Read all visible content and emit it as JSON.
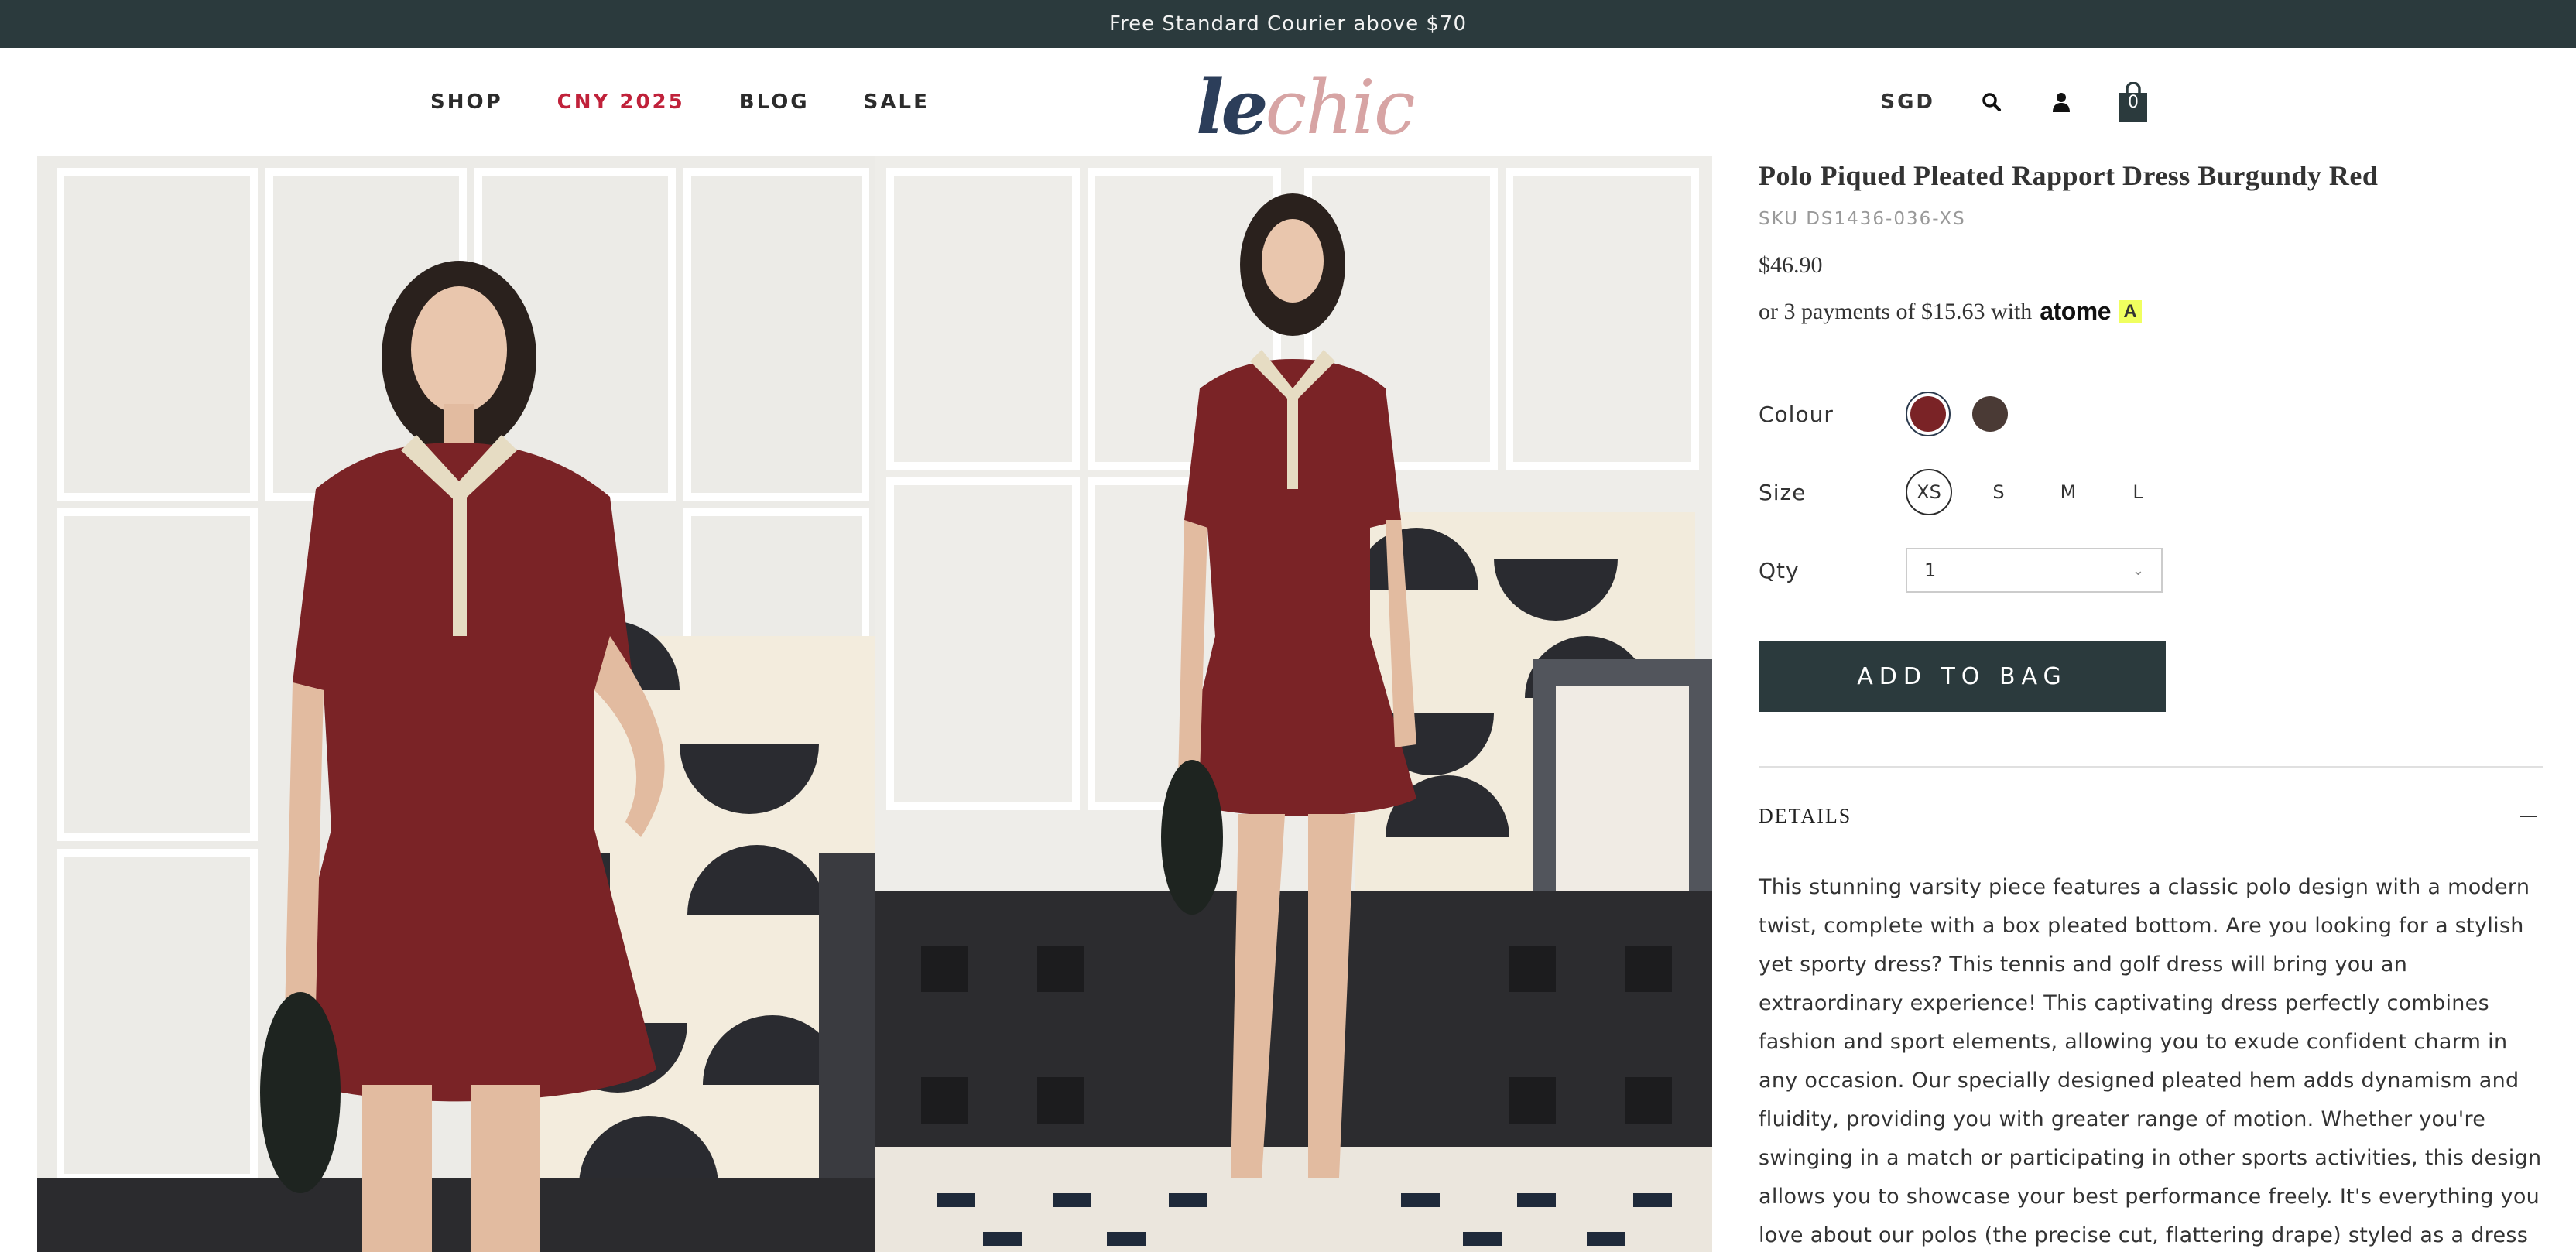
{
  "banner": {
    "text": "Free Standard Courier above $70"
  },
  "nav": {
    "shop": "SHOP",
    "cny": "CNY 2025",
    "blog": "BLOG",
    "sale": "SALE"
  },
  "logo": {
    "part1": "le",
    "part2": "chic"
  },
  "header": {
    "currency": "SGD",
    "bag_count": "0",
    "search_icon": "search-icon",
    "account_icon": "user-icon",
    "bag_icon": "shopping-bag-icon"
  },
  "product": {
    "title": "Polo Piqued Pleated Rapport Dress Burgundy Red",
    "sku": "SKU DS1436-036-XS",
    "price": "$46.90",
    "installment_text": "or 3 payments of $15.63 with",
    "installment_provider": "atome",
    "colour_label": "Colour",
    "colours": [
      "#7a2326",
      "#4a3a35"
    ],
    "size_label": "Size",
    "sizes": [
      "XS",
      "S",
      "M",
      "L"
    ],
    "selected_size": "XS",
    "qty_label": "Qty",
    "qty_value": "1",
    "add_to_bag": "ADD TO BAG",
    "details_heading": "DETAILS",
    "description": "This stunning varsity piece features a classic polo design with a modern twist, complete with a box pleated bottom. Are you looking for a stylish yet sporty dress? This tennis and golf dress will bring you an extraordinary experience! This captivating dress perfectly combines fashion and sport elements, allowing you to exude confident charm in any occasion. Our specially designed pleated hem adds dynamism and fluidity, providing you with greater range of motion. Whether you're swinging in a match or participating in other sports activities, this design allows you to showcase your best performance freely. It's everything you love about our polos (the precise cut, flattering drape) styled as a dress in comfortable, stretch cotton, and"
  },
  "colors": {
    "banner_bg": "#2b3a3d",
    "accent_red": "#c0213a",
    "dress": "#7a2326",
    "button_bg": "#2b3a3d"
  }
}
